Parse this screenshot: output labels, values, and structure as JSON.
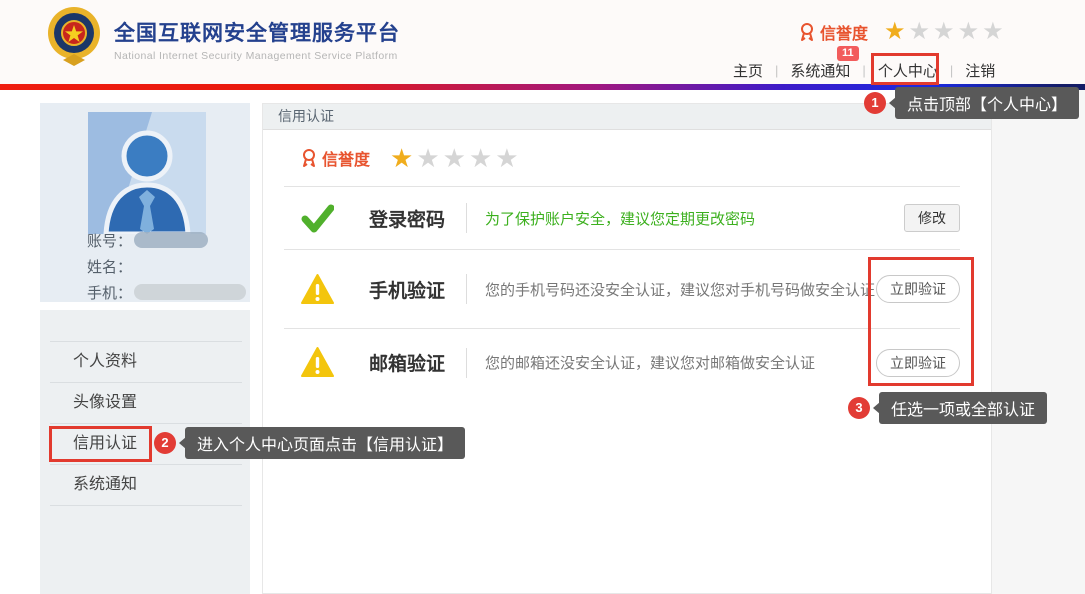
{
  "header": {
    "title": "全国互联网安全管理服务平台",
    "subtitle": "National Internet Security Management Service Platform",
    "reputation_label": "信誉度",
    "notification_count": "11",
    "nav": [
      "主页",
      "系统通知",
      "个人中心",
      "注销"
    ],
    "rating": {
      "filled": 1,
      "total": 5
    }
  },
  "sidebar": {
    "profile_fields": [
      "账号：",
      "姓名：",
      "手机："
    ],
    "menu": [
      "个人资料",
      "头像设置",
      "信用认证",
      "系统通知"
    ]
  },
  "main": {
    "panel_title": "信用认证",
    "reputation_label": "信誉度",
    "rating": {
      "filled": 1,
      "total": 5
    },
    "rows": [
      {
        "status": "ok",
        "label": "登录密码",
        "desc": "为了保护账户安全，建议您定期更改密码",
        "button": "修改"
      },
      {
        "status": "warn",
        "label": "手机验证",
        "desc": "您的手机号码还没安全认证，建议您对手机号码做安全认证",
        "button": "立即验证"
      },
      {
        "status": "warn",
        "label": "邮箱验证",
        "desc": "您的邮箱还没安全认证，建议您对邮箱做安全认证",
        "button": "立即验证"
      }
    ]
  },
  "callouts": [
    {
      "num": "1",
      "text": "点击顶部【个人中心】"
    },
    {
      "num": "2",
      "text": "进入个人中心页面点击【信用认证】"
    },
    {
      "num": "3",
      "text": "任选一项或全部认证"
    }
  ],
  "colors": {
    "annotation_red": "#e23a2e",
    "accent_orange": "#e8542f",
    "star_gold": "#f0ad1d",
    "star_gray": "#d5d5d5",
    "ok_green": "#50b02c",
    "warn_yellow": "#f3c50d",
    "title_blue": "#24418e",
    "badge_red": "#f25c5c"
  }
}
